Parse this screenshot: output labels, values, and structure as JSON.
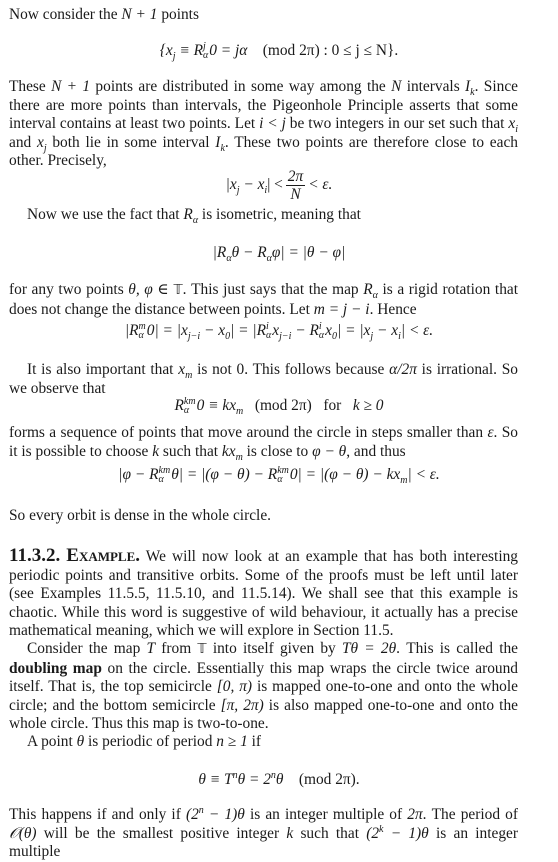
{
  "p1": {
    "lead": "Now consider the ",
    "math": "N + 1",
    "tail": " points"
  },
  "eq1": {
    "open": "{x",
    "sub_j": "j",
    "equiv": " ≡ R",
    "sup": "j",
    "sub": "α",
    "mid": "0 = jα",
    "mod": "(mod 2π) : 0 ≤ j ≤ N}."
  },
  "p2": {
    "text_a": "These ",
    "math_a": "N + 1",
    "text_b": " points are distributed in some way among the ",
    "math_b": "N",
    "text_c": " intervals ",
    "math_c": "I",
    "sub_c": "k",
    "text_d": ". Since there are more points than intervals, the Pigeonhole Principle asserts that some interval contains at least two points. Let ",
    "math_d": "i < j",
    "text_e": " be two integers in our set such that ",
    "math_e": "x",
    "sub_e": "i",
    "text_f": " and ",
    "math_f": "x",
    "sub_f": "j",
    "text_g": " both lie in some interval ",
    "math_g": "I",
    "sub_g": "k",
    "text_h": ". These two points are therefore close to each other. Precisely,"
  },
  "eq2": {
    "left": "|x",
    "sub_j": "j",
    "mid": " − x",
    "sub_i": "i",
    "rel": "| <",
    "num": "2π",
    "den": "N",
    "tail": "< ε."
  },
  "p3": {
    "text_a": "Now we use the fact that ",
    "math_a": "R",
    "sub_a": "α",
    "text_b": " is isometric, meaning that"
  },
  "eq3": {
    "a": "|R",
    "sub1": "α",
    "b": "θ − R",
    "sub2": "α",
    "c": "φ| = |θ − φ|"
  },
  "p4": {
    "text_a": "for any two points ",
    "math_a": "θ, φ ∈ ",
    "bb": "𝕋",
    "text_b": ". This just says that the map ",
    "math_b": "R",
    "sub_b": "α",
    "text_c": " is a rigid rotation that does not change the distance between points. Let ",
    "math_c": "m = j − i",
    "text_d": ". Hence"
  },
  "eq4": {
    "a": "|R",
    "sup1": "m",
    "sub1": "α",
    "b": "0| = |x",
    "s2": "j−i",
    "c": " − x",
    "s3": "0",
    "d": "| = |R",
    "sup4": "i",
    "sub4": "α",
    "e": "x",
    "s5": "j−i",
    "f": " − R",
    "sup6": "i",
    "sub6": "α",
    "g": "x",
    "s7": "0",
    "h": "| = |x",
    "s8": "j",
    "i": " − x",
    "s9": "i",
    "j": "| < ε."
  },
  "p5": {
    "text_a": "It is also important that ",
    "math_a": "x",
    "sub_a": "m",
    "text_b": " is not 0. This follows because ",
    "math_b": "α/2π",
    "text_c": " is irrational. So we observe that"
  },
  "eq5": {
    "a": "R",
    "sup": "km",
    "sub": "α",
    "b": "0 ≡ kx",
    "s": "m",
    "mod": "(mod 2π)",
    "for": "for",
    "cond": "k ≥ 0"
  },
  "p6": {
    "text_a": "forms a sequence of points that move around the circle in steps smaller than ",
    "math_a": "ε",
    "text_b": ". So it is possible to choose ",
    "math_b": "k",
    "text_c": " such that ",
    "math_c": "kx",
    "sub_c": "m",
    "text_d": " is close to ",
    "math_d": "φ − θ",
    "text_e": ", and thus"
  },
  "eq6": {
    "a": "|φ − R",
    "sup1": "km",
    "sub1": "α",
    "b": "θ| = |(φ − θ) − R",
    "sup2": "km",
    "sub2": "α",
    "c": "0| = |(φ − θ) − kx",
    "s3": "m",
    "d": "| < ε."
  },
  "p7": {
    "text": "So every orbit is dense in the whole circle."
  },
  "section": {
    "number": "11.3.2.",
    "title": "Example.",
    "text_a": " We will now look at an example that has both interesting periodic points and transitive orbits. Some of the proofs must be left until later (see Examples 11.5.5, 11.5.10, and 11.5.14). We shall see that this example is chaotic. While this word is suggestive of wild behaviour, it actually has a precise mathematical meaning, which we will explore in Section 11.5."
  },
  "p8": {
    "text_a": "Consider the map ",
    "math_a": "T",
    "text_b": " from ",
    "bb": "𝕋",
    "text_c": " into itself given by ",
    "math_c": "Tθ = 2θ",
    "text_d": ". This is called the ",
    "bold": "doubling map",
    "text_e": " on the circle. Essentially this map wraps the circle twice around itself. That is, the top semicircle ",
    "math_e": "[0, π)",
    "text_f": " is mapped one-to-one and onto the whole circle; and the bottom semicircle ",
    "math_f": "[π, 2π)",
    "text_g": " is also mapped one-to-one and onto the whole circle. Thus this map is two-to-one."
  },
  "p9": {
    "text_a": "A point ",
    "math_a": "θ",
    "text_b": " is periodic of period ",
    "math_b": "n ≥ 1",
    "text_c": " if"
  },
  "eq7": {
    "a": "θ ≡ T",
    "sup1": "n",
    "b": "θ = 2",
    "sup2": "n",
    "c": "θ",
    "mod": "(mod 2π)."
  },
  "p10": {
    "text_a": "This happens if and only if ",
    "math_a": "(2",
    "sup_a": "n",
    "math_a2": " − 1)θ",
    "text_b": " is an integer multiple of ",
    "math_b": "2π",
    "text_c": ". The period of ",
    "math_c": "𝒪(θ)",
    "text_d": " will be the smallest positive integer ",
    "math_d": "k",
    "text_e": " such that ",
    "math_e": "(2",
    "sup_e": "k",
    "math_e2": " − 1)θ",
    "text_f": " is an integer multiple"
  }
}
